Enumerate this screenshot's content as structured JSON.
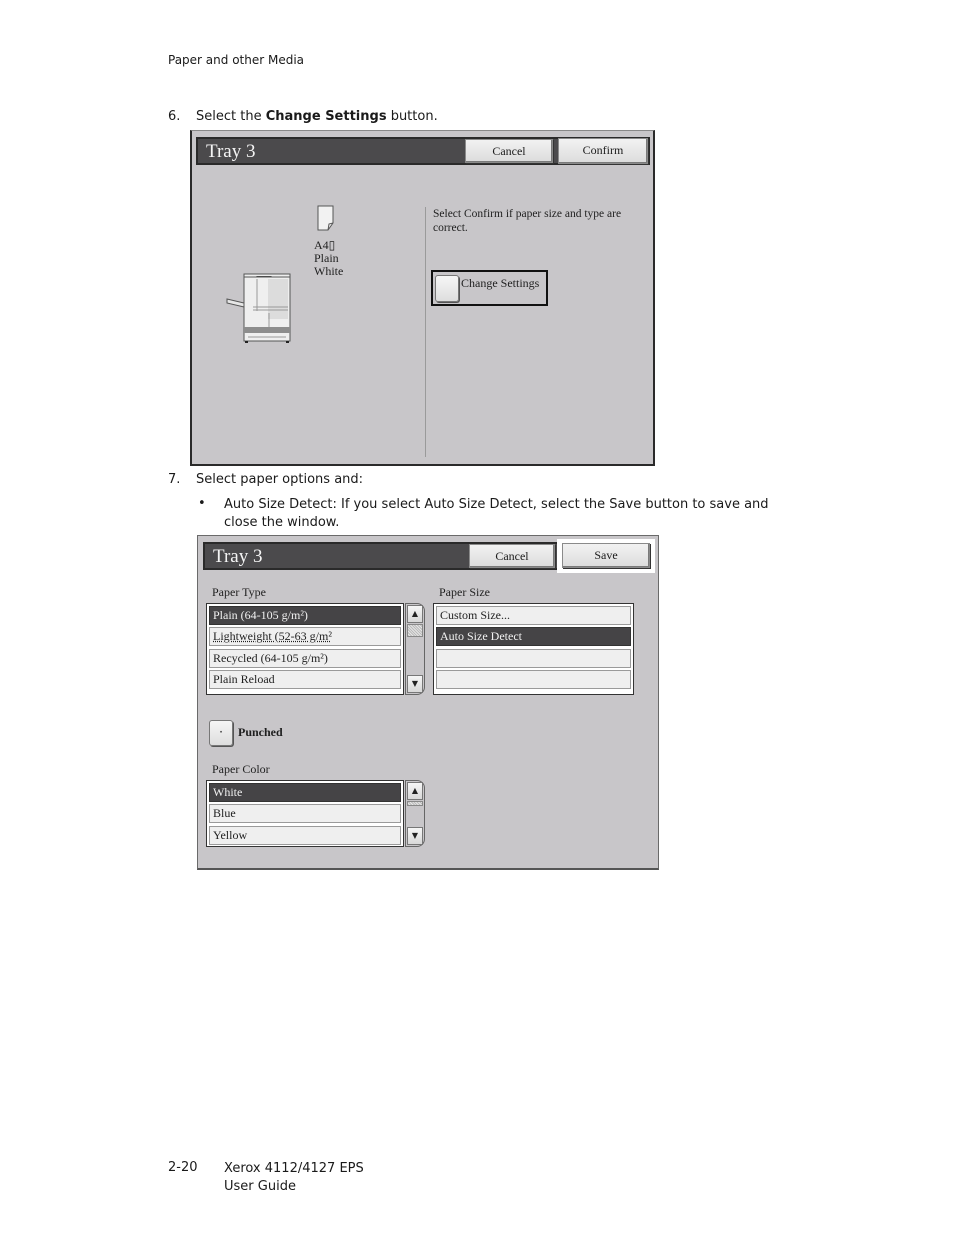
{
  "page": {
    "header": "Paper and other Media",
    "step6": {
      "number": "6.",
      "prefix": "Select the ",
      "bold": "Change Settings",
      "suffix": " button."
    },
    "step7": {
      "number": "7.",
      "text": "Select paper options and:"
    },
    "bullet": {
      "symbol": "•",
      "line1": "Auto Size Detect: If you select Auto Size Detect, select the Save button to save and",
      "line2": "close the window."
    },
    "footer": {
      "page_number": "2-20",
      "product": "Xerox 4112/4127 EPS",
      "guide": "User Guide"
    }
  },
  "screen1": {
    "title": "Tray 3",
    "cancel_label": "Cancel",
    "confirm_label": "Confirm",
    "paper_info": {
      "size": "A4▯",
      "type": "Plain",
      "color": "White"
    },
    "instruction_line1": "Select Confirm if paper size and type are",
    "instruction_line2": "correct.",
    "change_settings_label": "Change Settings"
  },
  "screen2": {
    "title": "Tray 3",
    "cancel_label": "Cancel",
    "save_label": "Save",
    "paper_type": {
      "label": "Paper Type",
      "items": [
        {
          "label": "Plain (64-105 g/m²)",
          "selected": true
        },
        {
          "label": "Lightweight (52-63 g/m²",
          "selected": false
        },
        {
          "label": "Recycled (64-105 g/m²)",
          "selected": false
        },
        {
          "label": "Plain Reload",
          "selected": false
        }
      ]
    },
    "paper_size": {
      "label": "Paper Size",
      "items": [
        {
          "label": "Custom Size...",
          "selected": false
        },
        {
          "label": "Auto Size Detect",
          "selected": true
        },
        {
          "label": "",
          "selected": false
        },
        {
          "label": "",
          "selected": false
        }
      ]
    },
    "punched": {
      "label": "Punched",
      "checked": false,
      "mark": "·"
    },
    "paper_color": {
      "label": "Paper Color",
      "items": [
        {
          "label": "White",
          "selected": true
        },
        {
          "label": "Blue",
          "selected": false
        },
        {
          "label": "Yellow",
          "selected": false
        }
      ]
    },
    "scroll_up": "▲",
    "scroll_down": "▼"
  }
}
